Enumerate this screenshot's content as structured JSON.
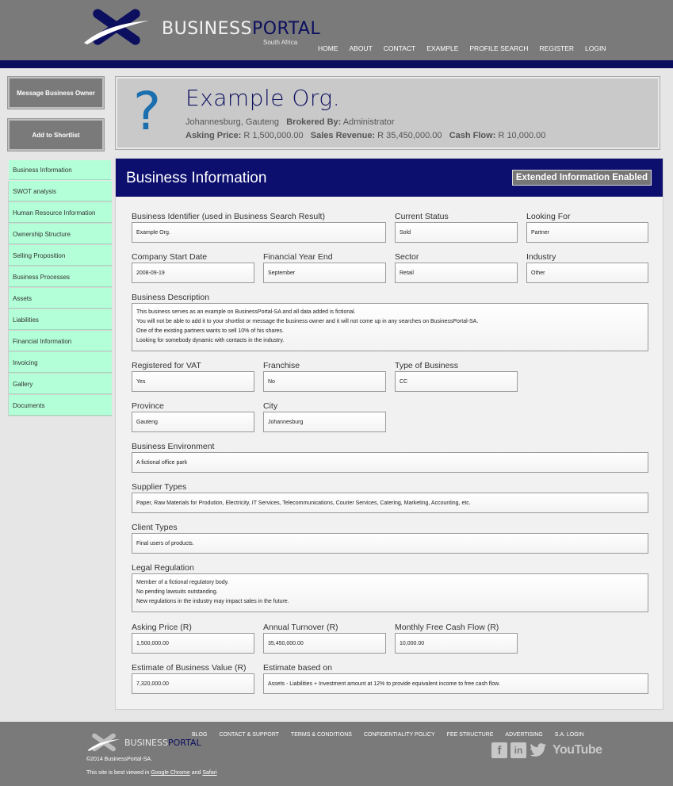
{
  "header": {
    "brand_part1": "BUSINESS",
    "brand_part2": "PORTAL",
    "brand_sub": "South Africa",
    "nav": [
      "HOME",
      "ABOUT",
      "CONTACT",
      "EXAMPLE",
      "PROFILE SEARCH",
      "REGISTER",
      "LOGIN"
    ]
  },
  "actions": {
    "message": "Message Business Owner",
    "shortlist": "Add to Shortlist"
  },
  "org": {
    "name": "Example Org.",
    "location": "Johannesburg, Gauteng",
    "brokered_label": "Brokered By:",
    "brokered_value": "Administrator",
    "asking_label": "Asking Price:",
    "asking_value": "R 1,500,000.00",
    "revenue_label": "Sales Revenue:",
    "revenue_value": "R 35,450,000.00",
    "cashflow_label": "Cash Flow:",
    "cashflow_value": "R 10,000.00"
  },
  "tabs": [
    "Business Information",
    "SWOT analysis",
    "Human Resource Information",
    "Ownership Structure",
    "Selling Proposition",
    "Business Processes",
    "Assets",
    "Liabilities",
    "Financial Information",
    "Invoicing",
    "Gallery",
    "Documents"
  ],
  "main": {
    "title": "Business Information",
    "badge": "Extended Information Enabled"
  },
  "fields": {
    "identifier": {
      "label": "Business Identifier (used in Business Search Result)",
      "value": "Example Org."
    },
    "status": {
      "label": "Current Status",
      "value": "Sold"
    },
    "looking": {
      "label": "Looking For",
      "value": "Partner"
    },
    "start_date": {
      "label": "Company Start Date",
      "value": "2008-09-19"
    },
    "fin_year": {
      "label": "Financial Year End",
      "value": "September"
    },
    "sector": {
      "label": "Sector",
      "value": "Retail"
    },
    "industry": {
      "label": "Industry",
      "value": "Other"
    },
    "description": {
      "label": "Business Description",
      "lines": [
        "This business serves as an example on BusinessPortal-SA and all data added is fictional.",
        "You will not be able to add it to your shortlist or message the business owner and it will not come up in any searches on BusinessPortal-SA.",
        "One of the existing partners wants to sell 10% of his shares.",
        "Looking for somebody dynamic with contacts in the industry."
      ]
    },
    "vat": {
      "label": "Registered for VAT",
      "value": "Yes"
    },
    "franchise": {
      "label": "Franchise",
      "value": "No"
    },
    "type": {
      "label": "Type of Business",
      "value": "CC"
    },
    "province": {
      "label": "Province",
      "value": "Gauteng"
    },
    "city": {
      "label": "City",
      "value": "Johannesburg"
    },
    "environment": {
      "label": "Business Environment",
      "value": "A fictional office park"
    },
    "suppliers": {
      "label": "Supplier Types",
      "value": "Paper, Raw Materials for Prodution, Electricity, IT Services, Telecommunications, Courier Services, Catering, Marketing, Accounting, etc."
    },
    "clients": {
      "label": "Client Types",
      "value": "Final users of products."
    },
    "legal": {
      "label": "Legal Regulation",
      "lines": [
        "Member of a fictional regulatory body.",
        "No pending lawsuits outstanding.",
        "New regulations in the industry may impact sales in the future."
      ]
    },
    "asking": {
      "label": "Asking Price (R)",
      "value": "1,500,000.00"
    },
    "turnover": {
      "label": "Annual Turnover (R)",
      "value": "35,450,000.00"
    },
    "free_cash": {
      "label": "Monthly Free Cash Flow (R)",
      "value": "10,000.00"
    },
    "estimate": {
      "label": "Estimate of Business Value (R)",
      "value": "7,320,000.00"
    },
    "basis": {
      "label": "Estimate based on",
      "value": "Assets - Liabilities + Investment amount at 12% to provide equivalent income to free cash flow."
    }
  },
  "footer": {
    "brand_part1": "BUSINESS",
    "brand_part2": "PORTAL",
    "nav": [
      "BLOG",
      "CONTACT & SUPPORT",
      "TERMS & CONDITIONS",
      "CONFIDENTIALITY POLICY",
      "FEE STRUCTURE",
      "ADVERTISING",
      "S.A. LOGIN"
    ],
    "copyright": "©2014 BusinessPortal-SA.",
    "best_prefix": "This site is best viewed in",
    "browser1": "Google Chrome",
    "and": "and",
    "browser2": "Safari",
    "youtube": "YouTube"
  }
}
